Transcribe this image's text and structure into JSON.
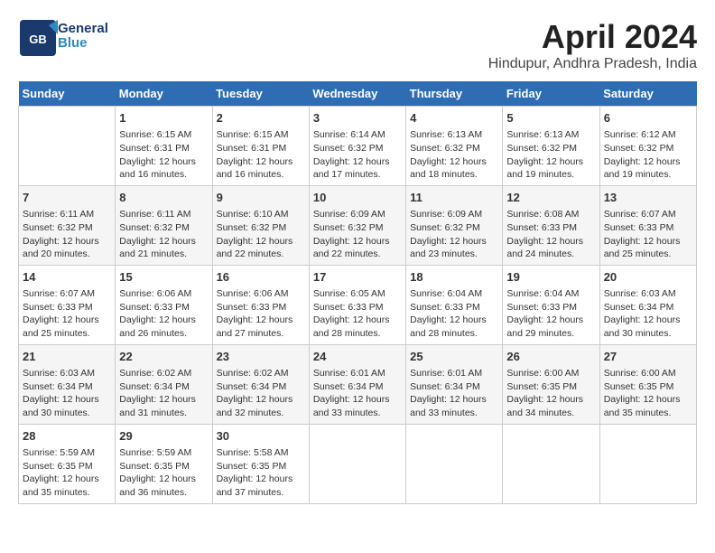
{
  "logo": {
    "line1": "General",
    "line2": "Blue"
  },
  "title": "April 2024",
  "subtitle": "Hindupur, Andhra Pradesh, India",
  "days_header": [
    "Sunday",
    "Monday",
    "Tuesday",
    "Wednesday",
    "Thursday",
    "Friday",
    "Saturday"
  ],
  "weeks": [
    [
      {
        "day": "",
        "sunrise": "",
        "sunset": "",
        "daylight": ""
      },
      {
        "day": "1",
        "sunrise": "Sunrise: 6:15 AM",
        "sunset": "Sunset: 6:31 PM",
        "daylight": "Daylight: 12 hours and 16 minutes."
      },
      {
        "day": "2",
        "sunrise": "Sunrise: 6:15 AM",
        "sunset": "Sunset: 6:31 PM",
        "daylight": "Daylight: 12 hours and 16 minutes."
      },
      {
        "day": "3",
        "sunrise": "Sunrise: 6:14 AM",
        "sunset": "Sunset: 6:32 PM",
        "daylight": "Daylight: 12 hours and 17 minutes."
      },
      {
        "day": "4",
        "sunrise": "Sunrise: 6:13 AM",
        "sunset": "Sunset: 6:32 PM",
        "daylight": "Daylight: 12 hours and 18 minutes."
      },
      {
        "day": "5",
        "sunrise": "Sunrise: 6:13 AM",
        "sunset": "Sunset: 6:32 PM",
        "daylight": "Daylight: 12 hours and 19 minutes."
      },
      {
        "day": "6",
        "sunrise": "Sunrise: 6:12 AM",
        "sunset": "Sunset: 6:32 PM",
        "daylight": "Daylight: 12 hours and 19 minutes."
      }
    ],
    [
      {
        "day": "7",
        "sunrise": "Sunrise: 6:11 AM",
        "sunset": "Sunset: 6:32 PM",
        "daylight": "Daylight: 12 hours and 20 minutes."
      },
      {
        "day": "8",
        "sunrise": "Sunrise: 6:11 AM",
        "sunset": "Sunset: 6:32 PM",
        "daylight": "Daylight: 12 hours and 21 minutes."
      },
      {
        "day": "9",
        "sunrise": "Sunrise: 6:10 AM",
        "sunset": "Sunset: 6:32 PM",
        "daylight": "Daylight: 12 hours and 22 minutes."
      },
      {
        "day": "10",
        "sunrise": "Sunrise: 6:09 AM",
        "sunset": "Sunset: 6:32 PM",
        "daylight": "Daylight: 12 hours and 22 minutes."
      },
      {
        "day": "11",
        "sunrise": "Sunrise: 6:09 AM",
        "sunset": "Sunset: 6:32 PM",
        "daylight": "Daylight: 12 hours and 23 minutes."
      },
      {
        "day": "12",
        "sunrise": "Sunrise: 6:08 AM",
        "sunset": "Sunset: 6:33 PM",
        "daylight": "Daylight: 12 hours and 24 minutes."
      },
      {
        "day": "13",
        "sunrise": "Sunrise: 6:07 AM",
        "sunset": "Sunset: 6:33 PM",
        "daylight": "Daylight: 12 hours and 25 minutes."
      }
    ],
    [
      {
        "day": "14",
        "sunrise": "Sunrise: 6:07 AM",
        "sunset": "Sunset: 6:33 PM",
        "daylight": "Daylight: 12 hours and 25 minutes."
      },
      {
        "day": "15",
        "sunrise": "Sunrise: 6:06 AM",
        "sunset": "Sunset: 6:33 PM",
        "daylight": "Daylight: 12 hours and 26 minutes."
      },
      {
        "day": "16",
        "sunrise": "Sunrise: 6:06 AM",
        "sunset": "Sunset: 6:33 PM",
        "daylight": "Daylight: 12 hours and 27 minutes."
      },
      {
        "day": "17",
        "sunrise": "Sunrise: 6:05 AM",
        "sunset": "Sunset: 6:33 PM",
        "daylight": "Daylight: 12 hours and 28 minutes."
      },
      {
        "day": "18",
        "sunrise": "Sunrise: 6:04 AM",
        "sunset": "Sunset: 6:33 PM",
        "daylight": "Daylight: 12 hours and 28 minutes."
      },
      {
        "day": "19",
        "sunrise": "Sunrise: 6:04 AM",
        "sunset": "Sunset: 6:33 PM",
        "daylight": "Daylight: 12 hours and 29 minutes."
      },
      {
        "day": "20",
        "sunrise": "Sunrise: 6:03 AM",
        "sunset": "Sunset: 6:34 PM",
        "daylight": "Daylight: 12 hours and 30 minutes."
      }
    ],
    [
      {
        "day": "21",
        "sunrise": "Sunrise: 6:03 AM",
        "sunset": "Sunset: 6:34 PM",
        "daylight": "Daylight: 12 hours and 30 minutes."
      },
      {
        "day": "22",
        "sunrise": "Sunrise: 6:02 AM",
        "sunset": "Sunset: 6:34 PM",
        "daylight": "Daylight: 12 hours and 31 minutes."
      },
      {
        "day": "23",
        "sunrise": "Sunrise: 6:02 AM",
        "sunset": "Sunset: 6:34 PM",
        "daylight": "Daylight: 12 hours and 32 minutes."
      },
      {
        "day": "24",
        "sunrise": "Sunrise: 6:01 AM",
        "sunset": "Sunset: 6:34 PM",
        "daylight": "Daylight: 12 hours and 33 minutes."
      },
      {
        "day": "25",
        "sunrise": "Sunrise: 6:01 AM",
        "sunset": "Sunset: 6:34 PM",
        "daylight": "Daylight: 12 hours and 33 minutes."
      },
      {
        "day": "26",
        "sunrise": "Sunrise: 6:00 AM",
        "sunset": "Sunset: 6:35 PM",
        "daylight": "Daylight: 12 hours and 34 minutes."
      },
      {
        "day": "27",
        "sunrise": "Sunrise: 6:00 AM",
        "sunset": "Sunset: 6:35 PM",
        "daylight": "Daylight: 12 hours and 35 minutes."
      }
    ],
    [
      {
        "day": "28",
        "sunrise": "Sunrise: 5:59 AM",
        "sunset": "Sunset: 6:35 PM",
        "daylight": "Daylight: 12 hours and 35 minutes."
      },
      {
        "day": "29",
        "sunrise": "Sunrise: 5:59 AM",
        "sunset": "Sunset: 6:35 PM",
        "daylight": "Daylight: 12 hours and 36 minutes."
      },
      {
        "day": "30",
        "sunrise": "Sunrise: 5:58 AM",
        "sunset": "Sunset: 6:35 PM",
        "daylight": "Daylight: 12 hours and 37 minutes."
      },
      {
        "day": "",
        "sunrise": "",
        "sunset": "",
        "daylight": ""
      },
      {
        "day": "",
        "sunrise": "",
        "sunset": "",
        "daylight": ""
      },
      {
        "day": "",
        "sunrise": "",
        "sunset": "",
        "daylight": ""
      },
      {
        "day": "",
        "sunrise": "",
        "sunset": "",
        "daylight": ""
      }
    ]
  ]
}
